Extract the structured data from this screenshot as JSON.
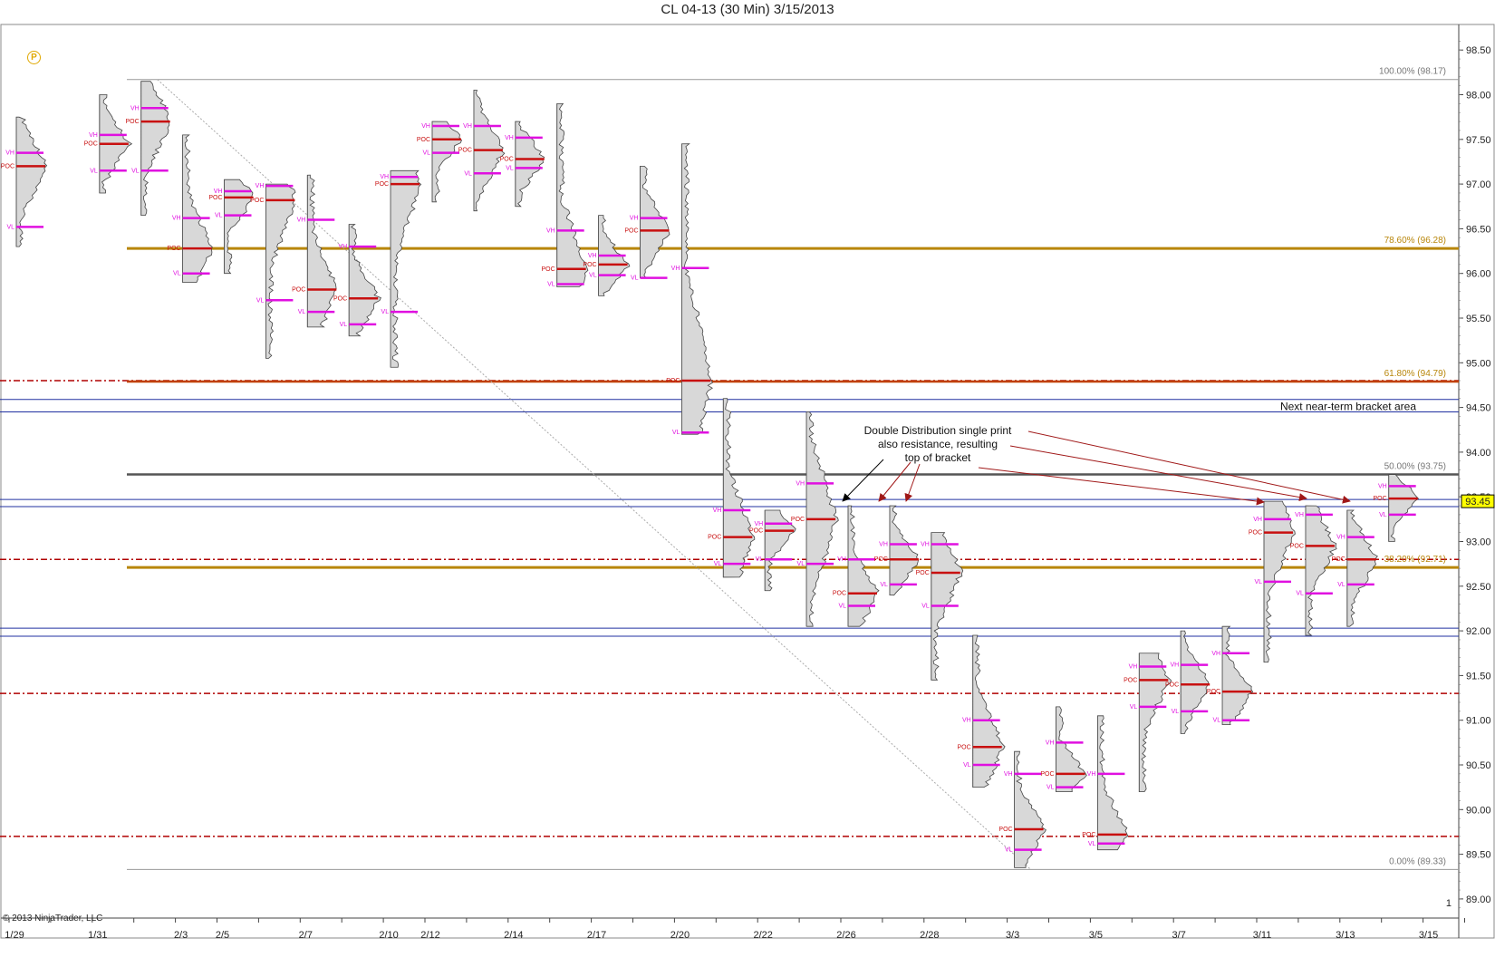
{
  "window": {
    "title": "CL 04-13 (30 Min)  3/15/2013"
  },
  "copyright": "© 2013 NinjaTrader, LLC",
  "logo_letter": "P",
  "colors": {
    "fib_gold": "#b8860b",
    "fib_orange": "#c04000",
    "fib_gray": "#555555",
    "red_dash": "#b00000",
    "blue_bracket": "#2030a0",
    "vh_vl": "#e010e0",
    "poc": "#c81010",
    "profile_fill": "#d8d8d8",
    "last_price_bg": "#ffff00"
  },
  "chart_data": {
    "type": "market-profile",
    "title": "CL 04-13 (30 Min)  3/15/2013",
    "y_axis": {
      "ylim": [
        88.9,
        98.6
      ],
      "ticks": [
        "98.50",
        "98.00",
        "97.50",
        "97.00",
        "96.50",
        "96.00",
        "95.50",
        "95.00",
        "94.50",
        "94.00",
        "93.50",
        "93.00",
        "92.50",
        "92.00",
        "91.50",
        "91.00",
        "90.50",
        "90.00",
        "89.50",
        "89.00"
      ],
      "tick_values": [
        98.5,
        98.0,
        97.5,
        97.0,
        96.5,
        96.0,
        95.5,
        95.0,
        94.5,
        94.0,
        93.5,
        93.0,
        92.5,
        92.0,
        91.5,
        91.0,
        90.5,
        90.0,
        89.5,
        89.0
      ],
      "last_price": "93.45",
      "last_price_value": 93.45,
      "extra_label": "1"
    },
    "x_axis": {
      "labels": [
        "1/29",
        "1/31",
        "2/3",
        "2/5",
        "2/7",
        "2/10",
        "2/12",
        "2/14",
        "2/17",
        "2/20",
        "2/22",
        "2/26",
        "2/28",
        "3/3",
        "3/5",
        "3/7",
        "3/11",
        "3/13",
        "3/15"
      ],
      "label_index": [
        0,
        2,
        4,
        5,
        7,
        9,
        10,
        12,
        14,
        16,
        18,
        20,
        22,
        24,
        26,
        28,
        30,
        32,
        34
      ]
    },
    "profile_labels": {
      "vh": "VH",
      "vl": "VL",
      "poc": "POC"
    },
    "fib_levels": [
      {
        "label": "100.00% (98.17)",
        "value": 98.17,
        "style": "thin-gray"
      },
      {
        "label": "78.60% (96.28)",
        "value": 96.28,
        "style": "gold"
      },
      {
        "label": "61.80% (94.79)",
        "value": 94.79,
        "style": "orange"
      },
      {
        "label": "50.00% (93.75)",
        "value": 93.75,
        "style": "gray"
      },
      {
        "label": "38.20% (92.71)",
        "value": 92.71,
        "style": "gold"
      },
      {
        "label": "0.00% (89.33)",
        "value": 89.33,
        "style": "thin-gray"
      }
    ],
    "red_dashed_levels": [
      94.8,
      92.8,
      91.3,
      89.7
    ],
    "blue_bracket_lines": [
      94.59,
      94.45,
      93.47,
      93.39,
      92.03,
      91.94
    ],
    "bracket_label": "Next near-term bracket area",
    "annotation": {
      "lines": [
        "Double Distribution single print",
        "also resistance, resulting",
        "top of bracket"
      ]
    },
    "profiles": [
      {
        "day": 0,
        "high": 97.75,
        "low": 96.3,
        "vh": 97.35,
        "poc": 97.2,
        "vl": 96.52
      },
      {
        "day": 2,
        "high": 98.0,
        "low": 96.9,
        "vh": 97.55,
        "poc": 97.45,
        "vl": 97.15
      },
      {
        "day": 3,
        "high": 98.15,
        "low": 96.65,
        "vh": 97.85,
        "poc": 97.7,
        "vl": 97.15
      },
      {
        "day": 4,
        "high": 97.55,
        "low": 95.9,
        "vh": 96.62,
        "poc": 96.28,
        "vl": 96.0
      },
      {
        "day": 5,
        "high": 97.05,
        "low": 96.0,
        "vh": 96.92,
        "poc": 96.85,
        "vl": 96.65
      },
      {
        "day": 6,
        "high": 97.0,
        "low": 95.05,
        "vh": 96.98,
        "poc": 96.82,
        "vl": 95.7
      },
      {
        "day": 7,
        "high": 97.1,
        "low": 95.4,
        "vh": 96.6,
        "poc": 95.82,
        "vl": 95.57
      },
      {
        "day": 8,
        "high": 96.55,
        "low": 95.3,
        "vh": 96.3,
        "poc": 95.72,
        "vl": 95.43
      },
      {
        "day": 9,
        "high": 97.15,
        "low": 94.95,
        "vh": 97.08,
        "poc": 97.0,
        "vl": 95.57
      },
      {
        "day": 10,
        "high": 97.7,
        "low": 96.8,
        "vh": 97.65,
        "poc": 97.5,
        "vl": 97.35
      },
      {
        "day": 11,
        "high": 98.05,
        "low": 96.7,
        "vh": 97.65,
        "poc": 97.38,
        "vl": 97.12
      },
      {
        "day": 12,
        "high": 97.7,
        "low": 96.75,
        "vh": 97.52,
        "poc": 97.28,
        "vl": 97.18
      },
      {
        "day": 13,
        "high": 97.9,
        "low": 95.85,
        "vh": 96.48,
        "poc": 96.05,
        "vl": 95.88
      },
      {
        "day": 14,
        "high": 96.65,
        "low": 95.75,
        "vh": 96.2,
        "poc": 96.1,
        "vl": 95.98
      },
      {
        "day": 15,
        "high": 97.2,
        "low": 95.95,
        "vh": 96.62,
        "poc": 96.48,
        "vl": 95.95
      },
      {
        "day": 16,
        "high": 97.45,
        "low": 94.2,
        "vh": 96.06,
        "poc": 94.8,
        "vl": 94.22
      },
      {
        "day": 17,
        "high": 94.6,
        "low": 92.6,
        "vh": 93.35,
        "poc": 93.05,
        "vl": 92.75
      },
      {
        "day": 18,
        "high": 93.35,
        "low": 92.45,
        "vh": 93.2,
        "poc": 93.12,
        "vl": 92.8
      },
      {
        "day": 19,
        "high": 94.45,
        "low": 92.05,
        "vh": 93.65,
        "poc": 93.25,
        "vl": 92.75
      },
      {
        "day": 20,
        "high": 93.4,
        "low": 92.05,
        "vh": 92.8,
        "poc": 92.42,
        "vl": 92.28
      },
      {
        "day": 21,
        "high": 93.4,
        "low": 92.4,
        "vh": 92.97,
        "poc": 92.8,
        "vl": 92.52
      },
      {
        "day": 22,
        "high": 93.1,
        "low": 91.45,
        "vh": 92.97,
        "poc": 92.65,
        "vl": 92.28
      },
      {
        "day": 23,
        "high": 91.95,
        "low": 90.25,
        "vh": 91.0,
        "poc": 90.7,
        "vl": 90.5
      },
      {
        "day": 24,
        "high": 90.65,
        "low": 89.35,
        "vh": 90.4,
        "poc": 89.78,
        "vl": 89.55
      },
      {
        "day": 25,
        "high": 91.15,
        "low": 90.2,
        "vh": 90.75,
        "poc": 90.4,
        "vl": 90.25
      },
      {
        "day": 26,
        "high": 91.05,
        "low": 89.55,
        "vh": 90.4,
        "poc": 89.72,
        "vl": 89.62
      },
      {
        "day": 27,
        "high": 91.75,
        "low": 90.2,
        "vh": 91.6,
        "poc": 91.45,
        "vl": 91.15
      },
      {
        "day": 28,
        "high": 92.0,
        "low": 90.85,
        "vh": 91.62,
        "poc": 91.4,
        "vl": 91.1
      },
      {
        "day": 29,
        "high": 92.05,
        "low": 90.95,
        "vh": 91.75,
        "poc": 91.32,
        "vl": 91.0
      },
      {
        "day": 30,
        "high": 93.45,
        "low": 91.65,
        "vh": 93.25,
        "poc": 93.1,
        "vl": 92.55
      },
      {
        "day": 31,
        "high": 93.4,
        "low": 91.95,
        "vh": 93.3,
        "poc": 92.95,
        "vl": 92.42
      },
      {
        "day": 32,
        "high": 93.35,
        "low": 92.05,
        "vh": 93.05,
        "poc": 92.8,
        "vl": 92.52
      },
      {
        "day": 33,
        "high": 93.75,
        "low": 93.0,
        "vh": 93.62,
        "poc": 93.48,
        "vl": 93.3
      }
    ]
  }
}
